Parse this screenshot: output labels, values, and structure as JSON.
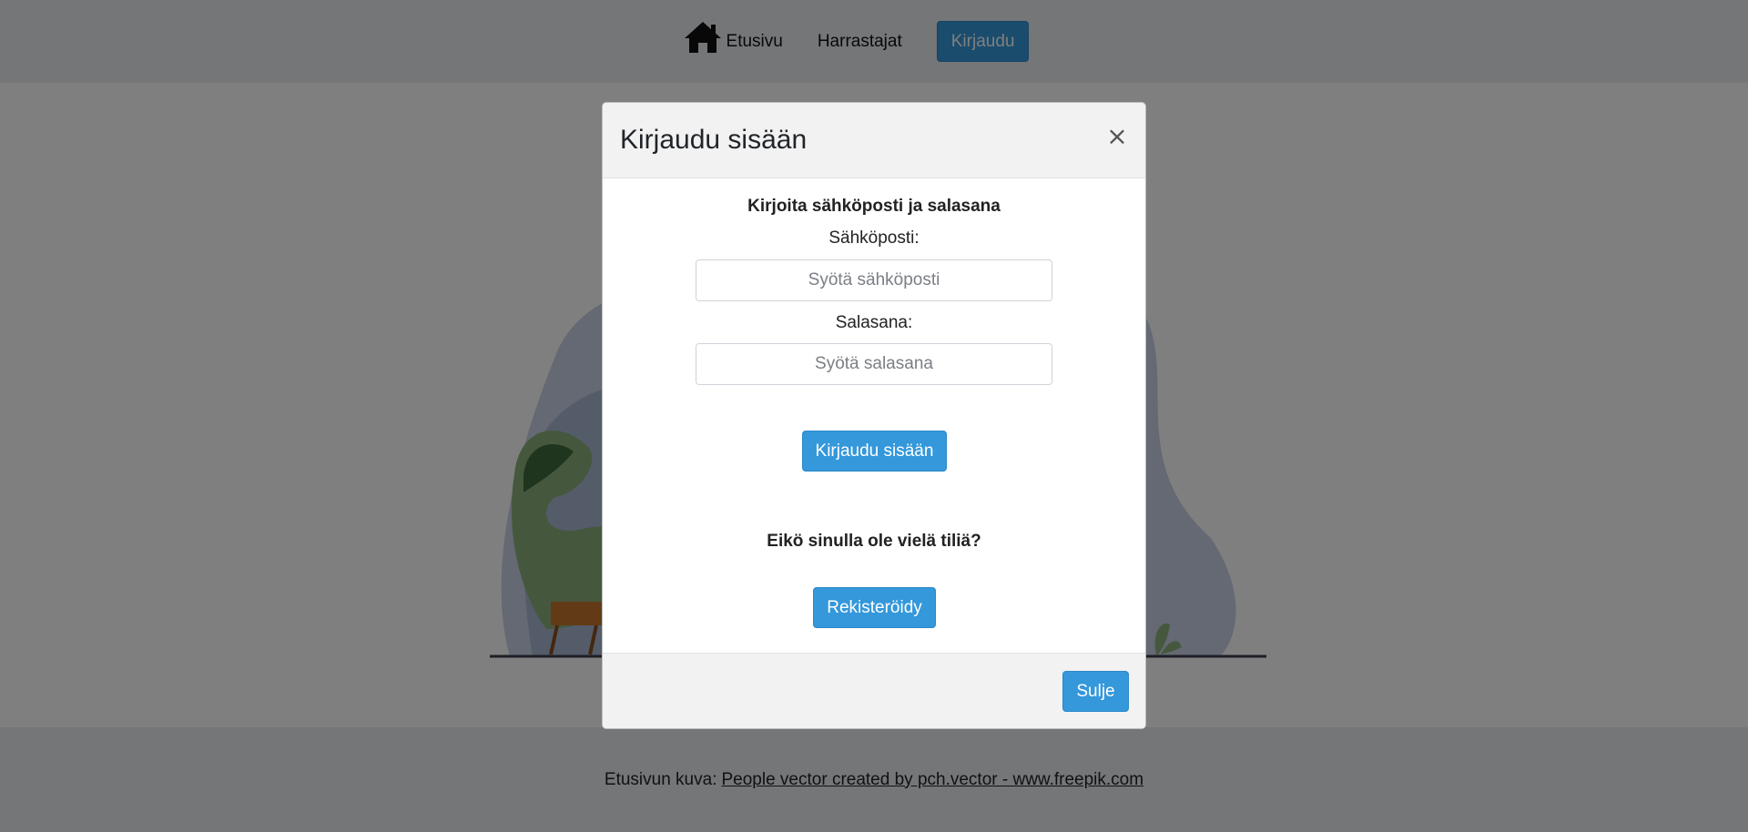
{
  "navbar": {
    "home_label": "Etusivu",
    "hobbyists_label": "Harrastajat",
    "login_label": "Kirjaudu"
  },
  "footer": {
    "prefix": "Etusivun kuva:",
    "link_text": "People vector created by pch.vector - www.freepik.com"
  },
  "modal": {
    "title": "Kirjaudu sisään",
    "close_glyph": "×",
    "prompt": "Kirjoita sähköposti ja salasana",
    "email_label": "Sähköposti:",
    "email_placeholder": "Syötä sähköposti",
    "password_label": "Salasana:",
    "password_placeholder": "Syötä salasana",
    "submit_label": "Kirjaudu sisään",
    "no_account_text": "Eikö sinulla ole vielä tiliä?",
    "register_label": "Rekisteröidy",
    "close_label": "Sulje"
  },
  "colors": {
    "primary": "#3498db",
    "navbar_bg": "#e8ecf1",
    "backdrop": "rgba(0,0,0,0.5)"
  }
}
